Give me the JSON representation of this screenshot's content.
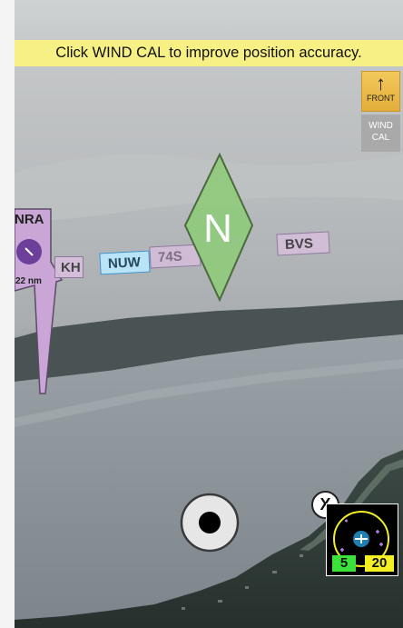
{
  "hint": {
    "text": "Click WIND CAL to improve position accuracy."
  },
  "controls": {
    "front": {
      "arrow": "↑",
      "label": "FRONT"
    },
    "wind_cal": {
      "label": "WIND\nCAL"
    }
  },
  "waypoints": [
    {
      "id": "NUW",
      "label": "NUW"
    },
    {
      "id": "74S",
      "label": "74S"
    },
    {
      "id": "BVS",
      "label": "BVS"
    },
    {
      "id": "KH",
      "label": "KH"
    }
  ],
  "airspace_marker": {
    "label": "NRA",
    "distance": "22 nm"
  },
  "compass": {
    "heading_label": "N"
  },
  "minimap": {
    "left_value": "5",
    "right_value": "20",
    "close_label": "X"
  },
  "colors": {
    "hint_bg": "#f7f084",
    "front_bg": "#e9b84a",
    "compass_fill": "#8fca7c",
    "airspace_fill": "#c9a6d6",
    "nuw_fill": "#b9e3f6",
    "map_left_bg": "#3ce23c",
    "map_right_bg": "#f4ef22"
  }
}
